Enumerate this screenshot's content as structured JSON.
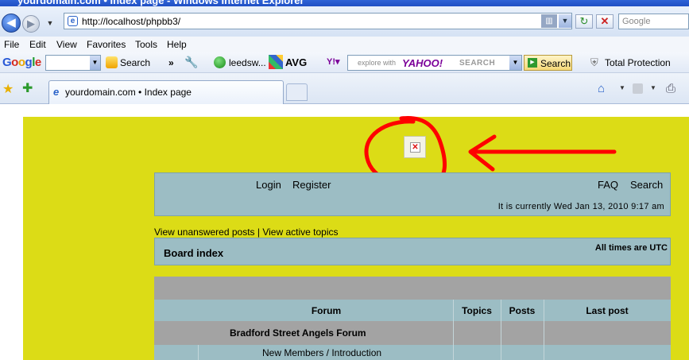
{
  "window": {
    "title": "yourdomain.com • Index page - Windows Internet Explorer"
  },
  "address_bar": {
    "url": "http://localhost/phpbb3/",
    "search_placeholder": "Google"
  },
  "menu": [
    "File",
    "Edit",
    "View",
    "Favorites",
    "Tools",
    "Help"
  ],
  "toolbar": {
    "google_search_label": "Search",
    "more_label": "»",
    "leedsw_label": "leedsw...",
    "avg_label": "AVG",
    "yahoo_placeholder": "explore with",
    "yahoo_logo": "YAHOO!",
    "yahoo_search_word": "SEARCH",
    "yahoo_button": "Search",
    "protection_label": "Total Protection"
  },
  "tab": {
    "title": "yourdomain.com • Index page"
  },
  "forum": {
    "header_links": {
      "login": "Login",
      "register": "Register",
      "faq": "FAQ",
      "search": "Search"
    },
    "current_time": "It is currently Wed Jan 13, 2010 9:17 am",
    "unanswered_link": "View unanswered posts",
    "separator": "|",
    "active_link": "View active topics",
    "board_index": "Board index",
    "timezone": "All times are UTC",
    "columns": [
      "Forum",
      "Topics",
      "Posts",
      "Last post"
    ],
    "category": "Bradford Street Angels Forum",
    "forum_row": "New Members / Introduction"
  },
  "colors": {
    "page_background": "#dcdc16",
    "panel": "#9cbdc4",
    "table_gray": "#a3a3a3",
    "annotation_red": "#ff0000"
  },
  "icons": [
    "back-arrow-icon",
    "forward-arrow-icon",
    "ie-page-icon",
    "refresh-icon",
    "stop-icon",
    "favorites-star-icon",
    "add-favorites-icon",
    "home-icon",
    "feeds-icon",
    "print-icon",
    "wrench-icon",
    "broken-image-icon"
  ]
}
